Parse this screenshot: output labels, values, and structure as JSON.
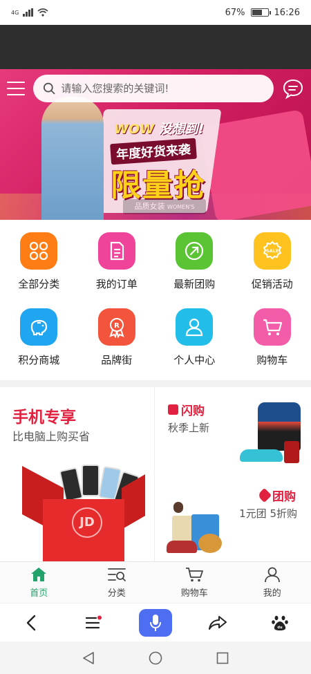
{
  "status_bar": {
    "network": "4G",
    "battery_percent": "67%",
    "battery_level": 0.67,
    "time": "16:26"
  },
  "search": {
    "placeholder": "请输入您搜索的关键词!"
  },
  "banner": {
    "wow": "WOW",
    "wow_tail": "没想到!",
    "annual": "年度好货来袭",
    "headline": "限量抢",
    "brand_cn": "品质女装",
    "brand_en": "WOMEN'S CLOTHES"
  },
  "categories": [
    {
      "label": "全部分类",
      "color": "#ff7d14",
      "icon": "grid-icon"
    },
    {
      "label": "我的订单",
      "color": "#f0449a",
      "icon": "order-icon"
    },
    {
      "label": "最新团购",
      "color": "#5bc434",
      "icon": "arrow-up-right-icon"
    },
    {
      "label": "促销活动",
      "color": "#ffc21f",
      "icon": "sale-tag-icon"
    },
    {
      "label": "积分商城",
      "color": "#20a5f0",
      "icon": "piggy-bank-icon"
    },
    {
      "label": "品牌街",
      "color": "#f2553c",
      "icon": "brand-badge-icon"
    },
    {
      "label": "个人中心",
      "color": "#22bde9",
      "icon": "user-icon"
    },
    {
      "label": "购物车",
      "color": "#f35ca8",
      "icon": "cart-icon"
    }
  ],
  "promo": {
    "mobile_title": "手机专享",
    "mobile_sub": "比电脑上购买省",
    "box_logo": "JD",
    "flash_title": "闪购",
    "flash_desc": "秋季上新",
    "group_title": "团购",
    "group_desc": "1元团 5折购"
  },
  "tabbar": {
    "home": "首页",
    "category": "分类",
    "cart": "购物车",
    "mine": "我的",
    "active": "home"
  },
  "colors": {
    "accent_red": "#e0213f",
    "tab_active": "#23a36b",
    "banner": "#d21f61",
    "mic": "#4e6ef2"
  }
}
